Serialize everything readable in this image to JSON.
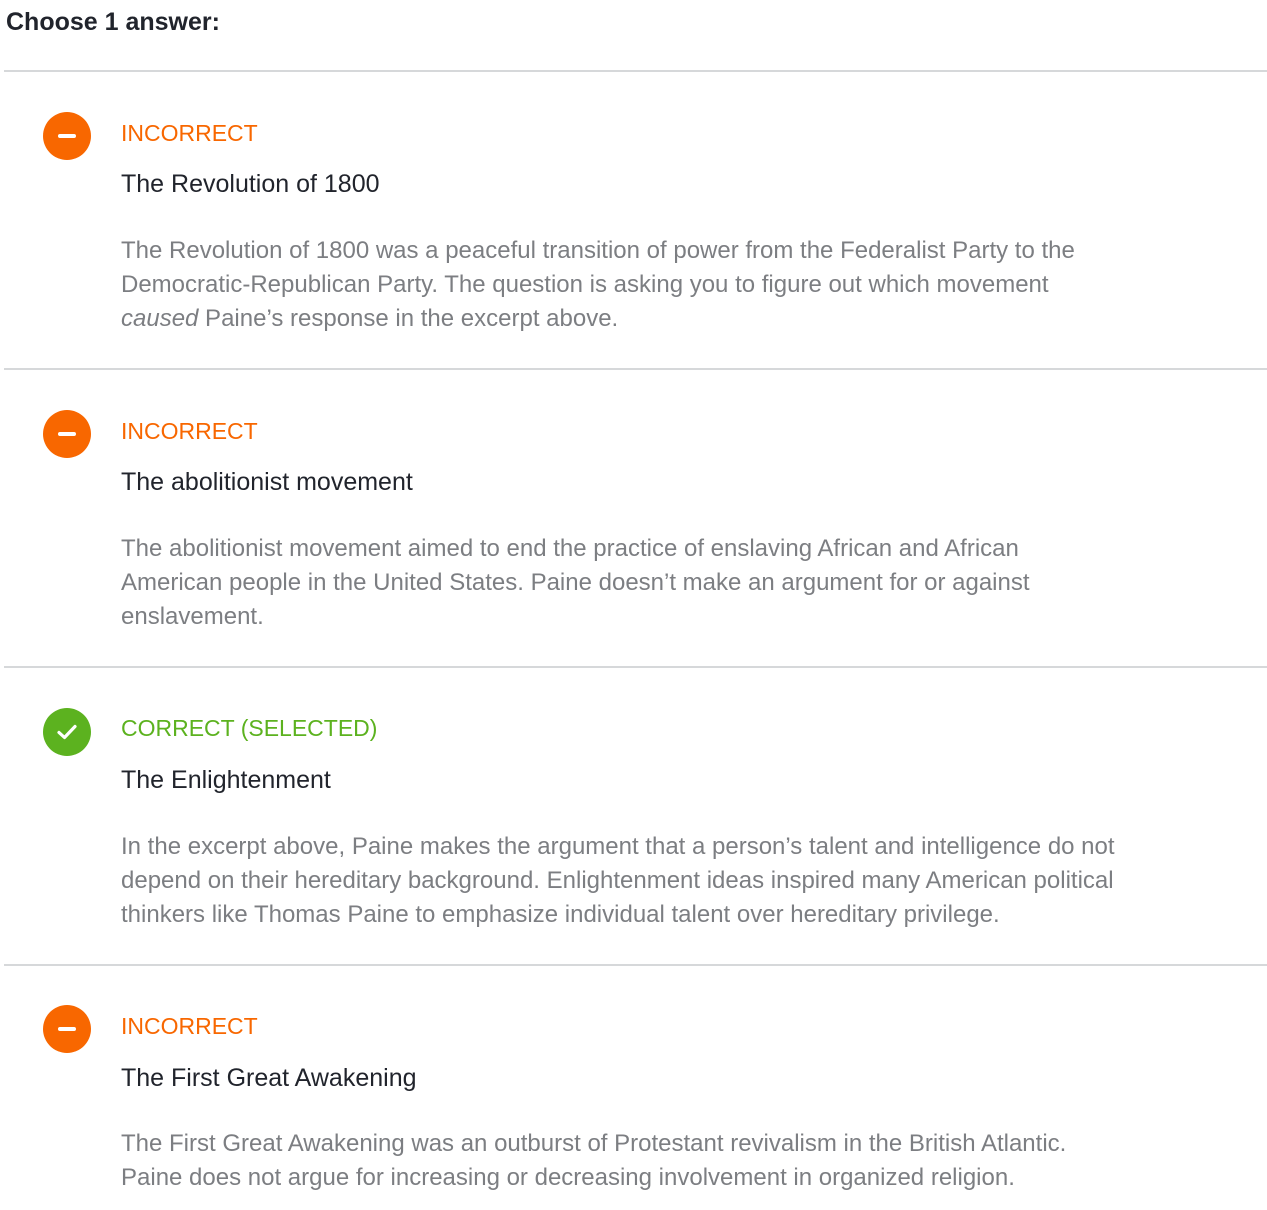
{
  "prompt": "Choose 1 answer:",
  "colors": {
    "incorrect": "#f86700",
    "correct": "#5cb21f",
    "explanation_text": "#7c7e82",
    "divider": "#d6d8da"
  },
  "choices": [
    {
      "status": "INCORRECT",
      "icon": "minus-icon",
      "text": "The Revolution of 1800",
      "explanation": {
        "line1": "The Revolution of 1800 was a peaceful transition of power from the Federalist Party to the",
        "line2": "Democratic-Republican Party. The question is asking you to figure out which movement",
        "line3_em": "caused",
        "line3_rest": " Paine’s response in the excerpt above."
      }
    },
    {
      "status": "INCORRECT",
      "icon": "minus-icon",
      "text": "The abolitionist movement",
      "explanation": {
        "line1": "The abolitionist movement aimed to end the practice of enslaving African and African",
        "line2": "American people in the United States. Paine doesn’t make an argument for or against",
        "line3": "enslavement."
      }
    },
    {
      "status": "CORRECT (SELECTED)",
      "icon": "checkmark-icon",
      "text": "The Enlightenment",
      "explanation": {
        "line1": "In the excerpt above, Paine makes the argument that a person’s talent and intelligence do not",
        "line2": "depend on their hereditary background. Enlightenment ideas inspired many American political",
        "line3": "thinkers like Thomas Paine to emphasize individual talent over hereditary privilege."
      }
    },
    {
      "status": "INCORRECT",
      "icon": "minus-icon",
      "text": "The First Great Awakening",
      "explanation": {
        "line1": "The First Great Awakening was an outburst of Protestant revivalism in the British Atlantic.",
        "line2": "Paine does not argue for increasing or decreasing involvement in organized religion."
      }
    }
  ]
}
